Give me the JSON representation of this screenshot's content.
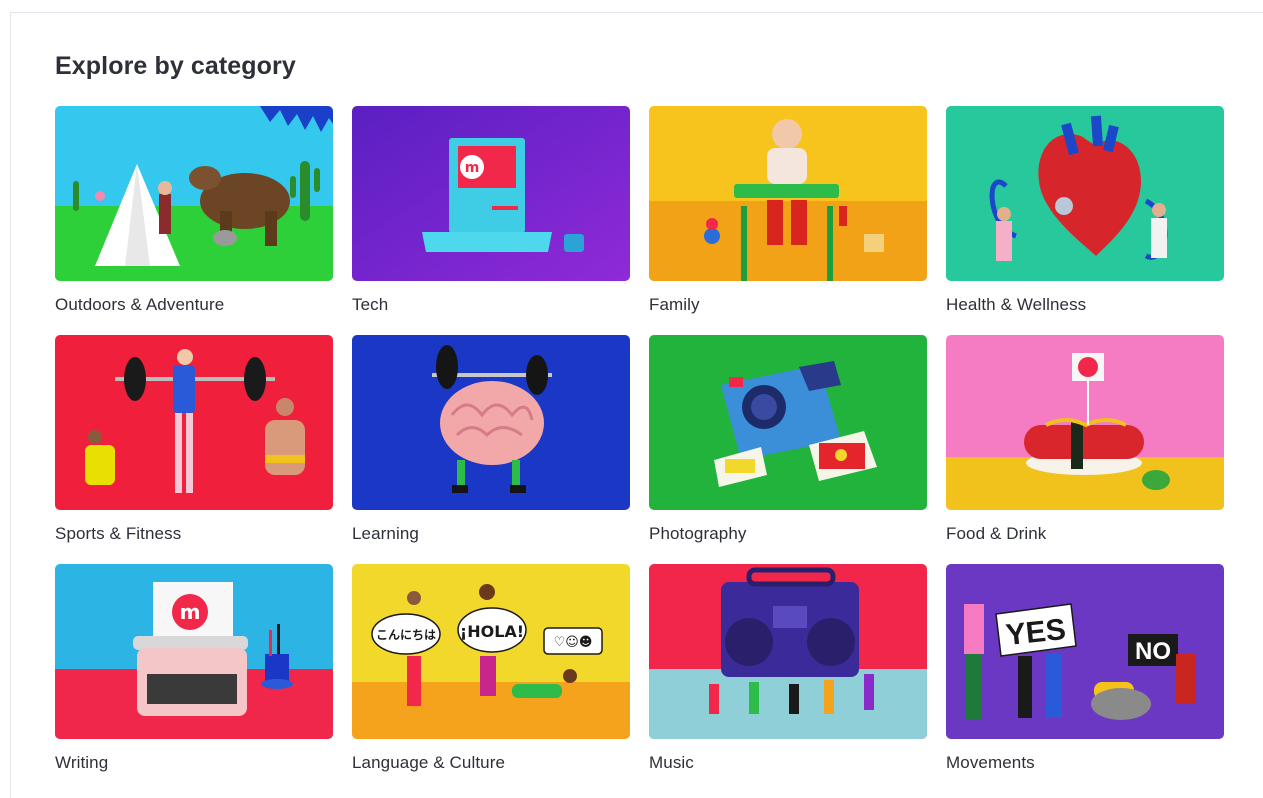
{
  "section": {
    "title": "Explore by category"
  },
  "categories": [
    {
      "label": "Outdoors & Adventure",
      "icon": "outdoors-scene-image",
      "bg": "#2ec8ee"
    },
    {
      "label": "Tech",
      "icon": "tech-computer-image",
      "bg": "#6b22c9"
    },
    {
      "label": "Family",
      "icon": "family-baby-image",
      "bg": "#f6c21c"
    },
    {
      "label": "Health & Wellness",
      "icon": "health-heart-image",
      "bg": "#25c99a"
    },
    {
      "label": "Sports & Fitness",
      "icon": "sports-weightlifting-image",
      "bg": "#f0203c"
    },
    {
      "label": "Learning",
      "icon": "learning-brain-image",
      "bg": "#1a37c5"
    },
    {
      "label": "Photography",
      "icon": "photography-camera-image",
      "bg": "#20b23c"
    },
    {
      "label": "Food & Drink",
      "icon": "food-hotdog-image",
      "bg": "#f57bc2"
    },
    {
      "label": "Writing",
      "icon": "writing-typewriter-image",
      "bg": "#2bb4e4"
    },
    {
      "label": "Language & Culture",
      "icon": "language-speech-image",
      "bg": "#f2d82b"
    },
    {
      "label": "Music",
      "icon": "music-boombox-image",
      "bg": "#f2254a"
    },
    {
      "label": "Movements",
      "icon": "movements-protest-image",
      "bg": "#6a38c2"
    }
  ],
  "artwork": {
    "speech_bubble_1": "こんにちは",
    "speech_bubble_2": "¡HOLA!",
    "sign_yes": "YES",
    "sign_no": "NO",
    "logo_letter": "m"
  }
}
